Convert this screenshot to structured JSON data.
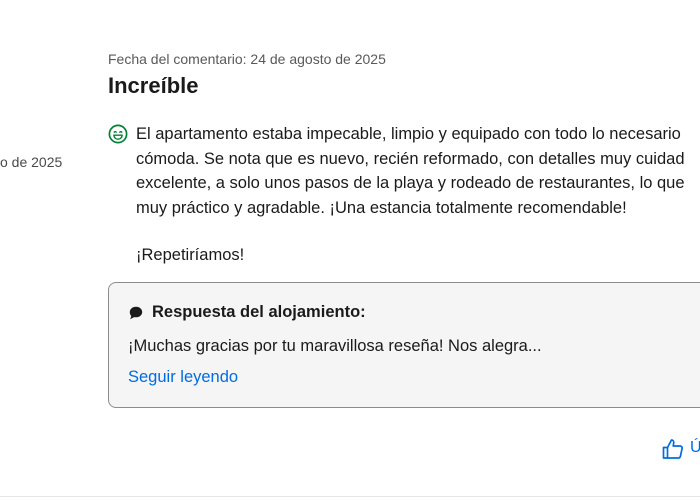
{
  "left_meta": {
    "dot": "·",
    "date_fragment": "o de 2025"
  },
  "review": {
    "date_label": "Fecha del comentario: 24 de agosto de 2025",
    "title": "Increíble",
    "sentiment_icon": "smiley-icon",
    "body_lines": [
      "El apartamento estaba impecable, limpio y equipado con todo lo necesario",
      "cómoda. Se nota que es nuevo, recién reformado, con detalles muy cuidad",
      "excelente, a solo unos pasos de la playa y rodeado de restaurantes, lo que",
      "muy práctico y agradable. ¡Una estancia totalmente recomendable!"
    ],
    "closing_line": "¡Repetiríamos!"
  },
  "response": {
    "icon": "chat-bubble-icon",
    "heading": "Respuesta del alojamiento:",
    "text": "¡Muchas gracias por tu maravillosa reseña! Nos alegra...",
    "read_more": "Seguir leyendo"
  },
  "actions": {
    "helpful_icon": "thumbs-up-icon",
    "helpful_fragment": "Ú"
  },
  "colors": {
    "link": "#006ce4",
    "smiley": "#008234",
    "text": "#1a1a1a",
    "muted": "#595959",
    "box_background": "#f5f5f5",
    "box_border": "#8c8c8c"
  }
}
